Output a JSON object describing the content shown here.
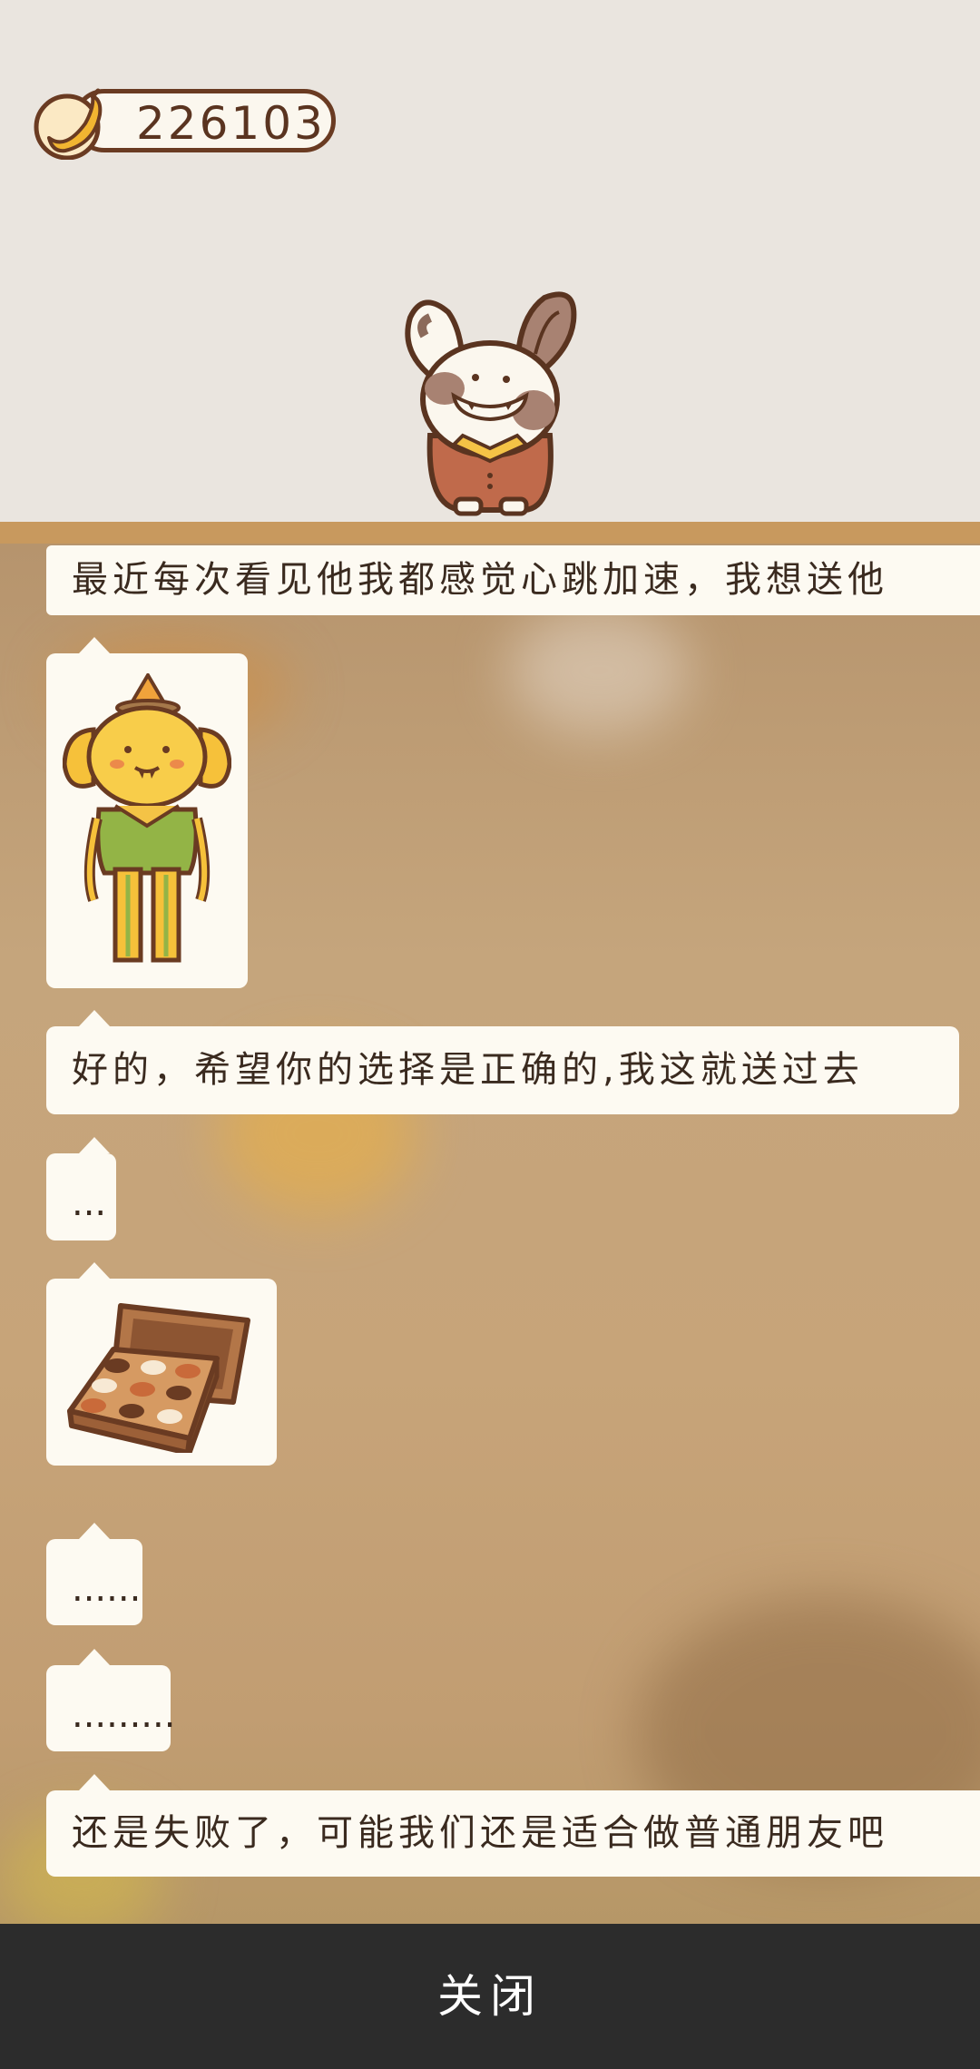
{
  "header": {
    "banana_count": "226103",
    "banana_icon": "banana-icon",
    "character": "rabbit-vampire-character"
  },
  "chat": {
    "messages": [
      {
        "type": "text",
        "text": "最近每次看见他我都感觉心跳加速，我想送他"
      },
      {
        "type": "image",
        "icon": "dog-character-portrait"
      },
      {
        "type": "text",
        "text": "好的，希望你的选择是正确的,我这就送过去"
      },
      {
        "type": "text",
        "text": "..."
      },
      {
        "type": "image",
        "icon": "chocolate-box-icon"
      },
      {
        "type": "text",
        "text": "......"
      },
      {
        "type": "text",
        "text": "........."
      },
      {
        "type": "text",
        "text": "还是失败了，可能我们还是适合做普通朋友吧"
      }
    ]
  },
  "footer": {
    "close_label": "关闭"
  },
  "colors": {
    "background_top": "#eae5df",
    "ledge": "#c8995e",
    "bubble": "#fdfaf2",
    "close_bar": "#2c2c2c",
    "counter_border": "#6a3b22"
  }
}
